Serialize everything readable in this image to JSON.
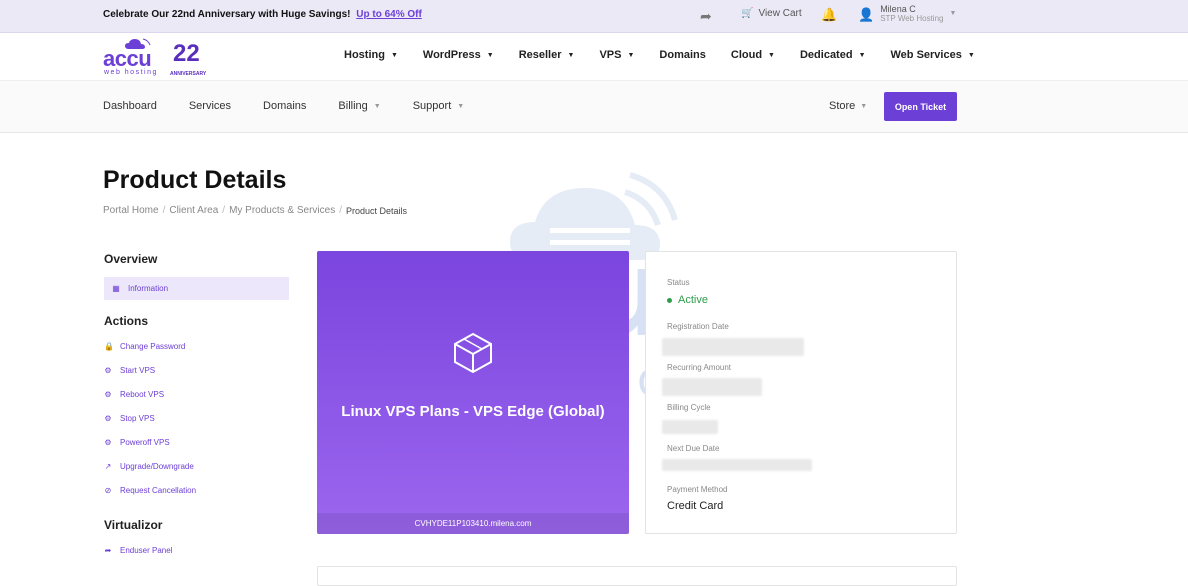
{
  "promo": {
    "text": "Celebrate Our 22nd Anniversary with Huge Savings!",
    "link": "Up to 64% Off"
  },
  "topbar": {
    "cart_label": "View Cart",
    "user_name": "Milena C",
    "user_company": "STP Web Hosting"
  },
  "logo": {
    "wordmark": "accu",
    "tagline": "web hosting",
    "anniversary_number": "22",
    "anniversary_label": "ANNIVERSARY"
  },
  "main_menu": [
    {
      "label": "Hosting",
      "dropdown": true
    },
    {
      "label": "WordPress",
      "dropdown": true
    },
    {
      "label": "Reseller",
      "dropdown": true
    },
    {
      "label": "VPS",
      "dropdown": true
    },
    {
      "label": "Domains",
      "dropdown": false
    },
    {
      "label": "Cloud",
      "dropdown": true
    },
    {
      "label": "Dedicated",
      "dropdown": true
    },
    {
      "label": "Web Services",
      "dropdown": true
    }
  ],
  "subnav": {
    "items": [
      {
        "label": "Dashboard"
      },
      {
        "label": "Services"
      },
      {
        "label": "Domains"
      },
      {
        "label": "Billing"
      },
      {
        "label": "Support"
      }
    ],
    "store": "Store",
    "open_ticket": "Open Ticket"
  },
  "page": {
    "title": "Product Details",
    "breadcrumb": [
      "Portal Home",
      "Client Area",
      "My Products & Services",
      "Product Details"
    ]
  },
  "sidebar": {
    "overview_heading": "Overview",
    "overview_item": "Information",
    "actions_heading": "Actions",
    "actions": [
      {
        "label": "Change Password",
        "icon": "lock-icon"
      },
      {
        "label": "Start VPS",
        "icon": "gears-icon"
      },
      {
        "label": "Reboot VPS",
        "icon": "gears-icon"
      },
      {
        "label": "Stop VPS",
        "icon": "gears-icon"
      },
      {
        "label": "Poweroff VPS",
        "icon": "gears-icon"
      },
      {
        "label": "Upgrade/Downgrade",
        "icon": "external-link-icon"
      },
      {
        "label": "Request Cancellation",
        "icon": "ban-icon"
      }
    ],
    "virtualizor_heading": "Virtualizor",
    "virtualizor_item": "Enduser Panel"
  },
  "product": {
    "name": "Linux VPS Plans - VPS Edge (Global)",
    "domain": "CVHYDE11P103410.milena.com"
  },
  "details": {
    "status_label": "Status",
    "status_value": "Active",
    "registration_label": "Registration Date",
    "recurring_label": "Recurring Amount",
    "billing_cycle_label": "Billing Cycle",
    "next_due_label": "Next Due Date",
    "payment_method_label": "Payment Method",
    "payment_method_value": "Credit Card"
  },
  "colors": {
    "brand": "#6c3fd6",
    "status_active": "#2e9e4a"
  }
}
